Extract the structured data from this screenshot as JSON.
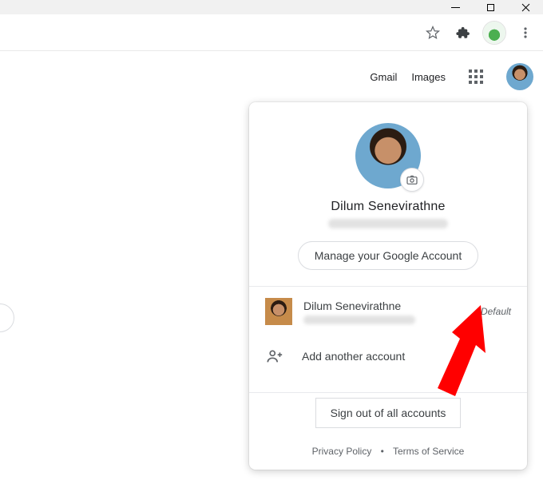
{
  "nav": {
    "gmail": "Gmail",
    "images": "Images"
  },
  "account": {
    "name": "Dilum Senevirathne",
    "manage": "Manage your Google Account",
    "other_name": "Dilum Senevirathne",
    "default_tag": "Default",
    "add_another": "Add another account",
    "signout": "Sign out of all accounts"
  },
  "footer": {
    "privacy": "Privacy Policy",
    "tos": "Terms of Service"
  }
}
